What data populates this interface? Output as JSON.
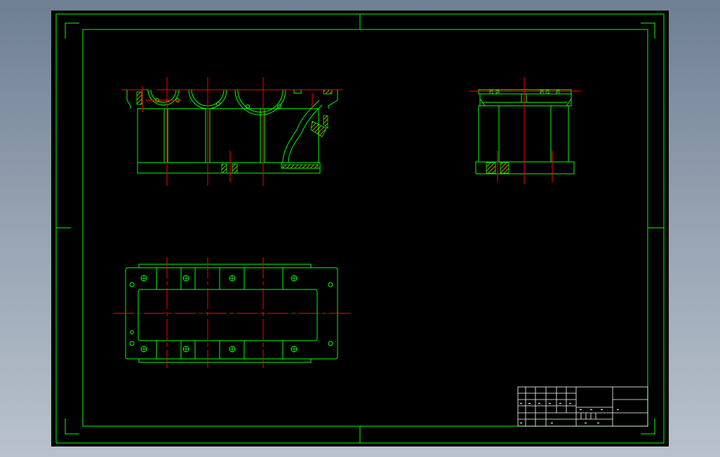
{
  "colors": {
    "background": "#000000",
    "frame": "#00ff00",
    "part": "#00ff00",
    "centerline": "#ff0000",
    "hatch": "#ffff00",
    "title_block": "#ffffff"
  },
  "views": [
    {
      "name": "front-section-view"
    },
    {
      "name": "side-view"
    },
    {
      "name": "top-view"
    }
  ],
  "title_block": {
    "text": ""
  }
}
